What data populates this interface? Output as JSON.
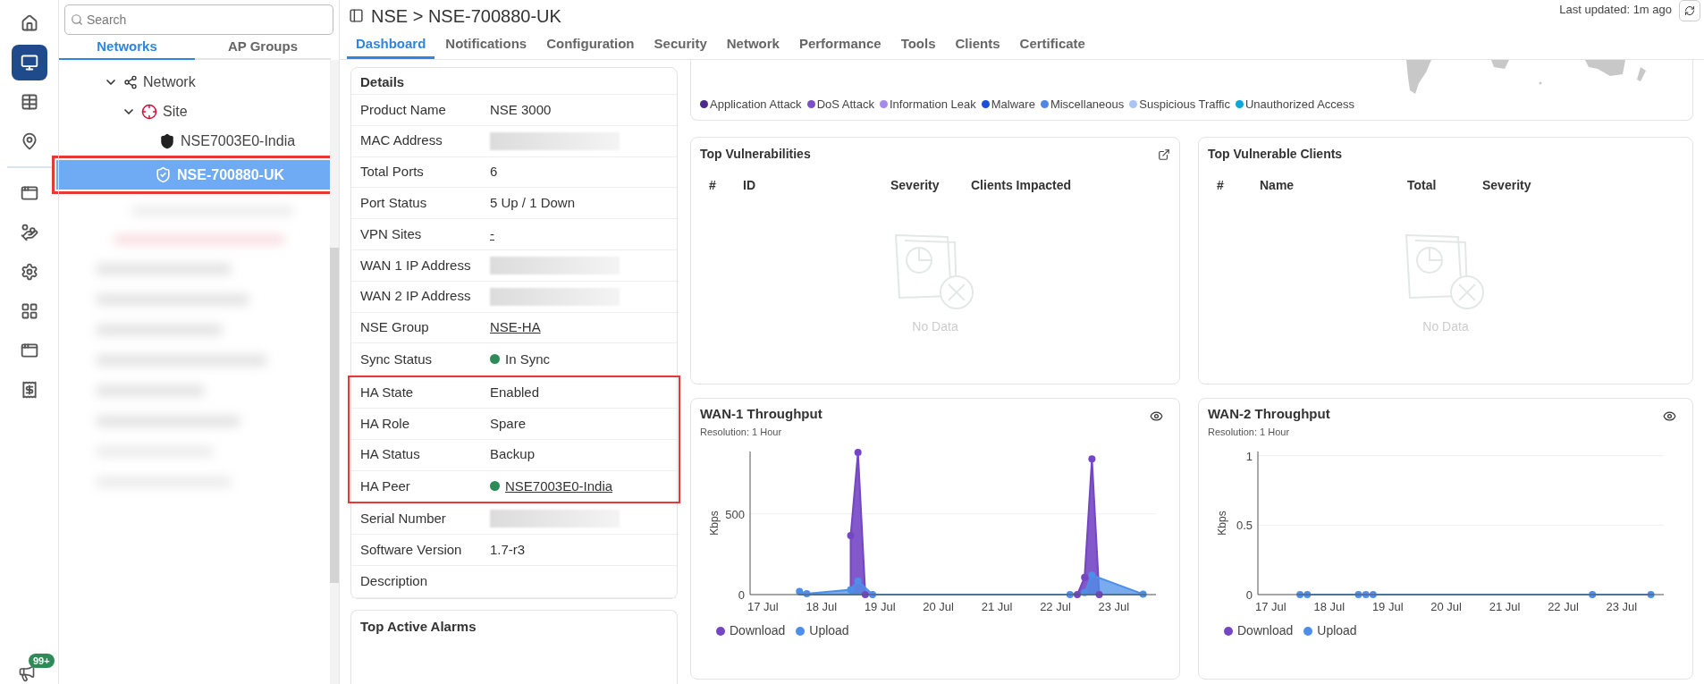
{
  "rail": {
    "items": [
      {
        "selected": false
      },
      {
        "selected": true
      },
      {
        "selected": false
      },
      {
        "selected": false
      },
      {
        "selected": false
      },
      {
        "selected": false
      },
      {
        "selected": false
      },
      {
        "selected": false
      },
      {
        "selected": false
      },
      {
        "selected": false
      }
    ],
    "badge": "99+"
  },
  "tree_panel": {
    "search": {
      "placeholder": "Search"
    },
    "tabs": [
      {
        "label": "Networks",
        "selected": true
      },
      {
        "label": "AP Groups",
        "selected": false
      }
    ],
    "tree": [
      {
        "kind": "network",
        "label": "Network",
        "expanded": true,
        "selected": false,
        "highlighted": false,
        "children": [
          {
            "kind": "site",
            "label": "Site",
            "expanded": true,
            "selected": false,
            "highlighted": false,
            "children": [
              {
                "kind": "nse",
                "label": "NSE7003E0-India",
                "selected": false,
                "highlighted": false
              },
              {
                "kind": "nse",
                "label": "NSE-700880-UK",
                "selected": true,
                "highlighted": true
              }
            ]
          }
        ]
      }
    ]
  },
  "header": {
    "breadcrumb": "NSE > NSE-700880-UK",
    "last_updated": "Last updated: 1m ago"
  },
  "tabs": [
    {
      "label": "Dashboard",
      "selected": true
    },
    {
      "label": "Notifications",
      "selected": false
    },
    {
      "label": "Configuration",
      "selected": false
    },
    {
      "label": "Security",
      "selected": false
    },
    {
      "label": "Network",
      "selected": false
    },
    {
      "label": "Performance",
      "selected": false
    },
    {
      "label": "Tools",
      "selected": false
    },
    {
      "label": "Clients",
      "selected": false
    },
    {
      "label": "Certificate",
      "selected": false
    }
  ],
  "details": {
    "title": "Details",
    "sections": [
      {
        "highlighted": false,
        "rows": [
          {
            "label": "Product Name",
            "kind": "text",
            "value": "NSE 3000"
          },
          {
            "label": "MAC Address",
            "kind": "redacted"
          },
          {
            "label": "Total Ports",
            "kind": "text",
            "value": "6"
          },
          {
            "label": "Port Status",
            "kind": "text",
            "value": "5 Up / 1 Down"
          },
          {
            "label": "VPN Sites",
            "kind": "link",
            "value": "-"
          },
          {
            "label": "WAN 1 IP Address",
            "kind": "redacted"
          },
          {
            "label": "WAN 2 IP Address",
            "kind": "redacted"
          },
          {
            "label": "NSE Group",
            "kind": "link",
            "value": "NSE-HA"
          },
          {
            "label": "Sync Status",
            "kind": "status",
            "value": "In Sync",
            "color": "#2e8b57"
          }
        ]
      },
      {
        "highlighted": true,
        "rows": [
          {
            "label": "HA State",
            "kind": "text",
            "value": "Enabled"
          },
          {
            "label": "HA Role",
            "kind": "text",
            "value": "Spare"
          },
          {
            "label": "HA Status",
            "kind": "text",
            "value": "Backup"
          },
          {
            "label": "HA Peer",
            "kind": "status_link",
            "value": "NSE7003E0-India",
            "color": "#2e8b57"
          }
        ]
      },
      {
        "highlighted": false,
        "rows": [
          {
            "label": "Serial Number",
            "kind": "redacted"
          },
          {
            "label": "Software Version",
            "kind": "text",
            "value": "1.7-r3"
          },
          {
            "label": "Description",
            "kind": "text"
          }
        ]
      }
    ]
  },
  "alarms": {
    "title": "Top Active Alarms"
  },
  "threat_map": {
    "legend": [
      {
        "label": "Application Attack",
        "color": "#4a2a8c"
      },
      {
        "label": "DoS Attack",
        "color": "#7b4fc6"
      },
      {
        "label": "Information Leak",
        "color": "#a68be6"
      },
      {
        "label": "Malware",
        "color": "#1b4fd8"
      },
      {
        "label": "Miscellaneous",
        "color": "#4f87e3"
      },
      {
        "label": "Suspicious Traffic",
        "color": "#a9c4f4"
      },
      {
        "label": "Unauthorized Access",
        "color": "#0ba6da"
      }
    ]
  },
  "vulnerabilities": {
    "title": "Top Vulnerabilities",
    "columns": [
      "#",
      "ID",
      "Severity",
      "Clients Impacted"
    ],
    "empty": "No Data"
  },
  "vulnerable_clients": {
    "title": "Top Vulnerable Clients",
    "columns": [
      "#",
      "Name",
      "Total",
      "Severity"
    ],
    "empty": "No Data"
  },
  "wan1": {
    "title": "WAN-1 Throughput",
    "subtitle": "Resolution: 1 Hour",
    "chart_data": {
      "type": "area",
      "ylabel": "Kbps",
      "categories": [
        "17 Jul",
        null,
        null,
        null,
        null,
        null,
        null,
        null,
        "18 Jul",
        null,
        null,
        null,
        null,
        null,
        null,
        null,
        "19 Jul",
        null,
        null,
        null,
        null,
        null,
        null,
        null,
        "20 Jul",
        null,
        null,
        null,
        null,
        null,
        null,
        null,
        "21 Jul",
        null,
        null,
        null,
        null,
        null,
        null,
        null,
        "22 Jul",
        null,
        null,
        null,
        null,
        null,
        null,
        null,
        "23 Jul",
        null,
        null,
        null,
        null,
        null
      ],
      "ylim": [
        0,
        886
      ],
      "yticks": [
        0,
        500
      ],
      "series": [
        {
          "name": "Download",
          "color": "#7446c4",
          "marker": "circle",
          "values": [
            null,
            null,
            null,
            null,
            null,
            null,
            null,
            null,
            null,
            null,
            null,
            null,
            365,
            880,
            0,
            null,
            null,
            null,
            null,
            null,
            null,
            null,
            null,
            null,
            null,
            null,
            null,
            null,
            null,
            null,
            null,
            null,
            null,
            null,
            null,
            null,
            null,
            null,
            null,
            null,
            null,
            null,
            null,
            0,
            107,
            840,
            0,
            null,
            null,
            null,
            null,
            null,
            null,
            null
          ]
        },
        {
          "name": "Upload",
          "color": "#4d8fe8",
          "marker": "circle",
          "values": [
            null,
            null,
            null,
            null,
            null,
            20,
            6,
            null,
            null,
            null,
            null,
            null,
            30,
            85,
            null,
            0,
            null,
            null,
            null,
            null,
            null,
            null,
            null,
            null,
            null,
            null,
            null,
            null,
            null,
            null,
            null,
            null,
            null,
            null,
            null,
            null,
            null,
            null,
            null,
            null,
            null,
            null,
            0,
            null,
            13,
            120,
            null,
            null,
            null,
            null,
            null,
            null,
            3,
            null
          ]
        }
      ],
      "legend": "bottom-left"
    }
  },
  "wan2": {
    "title": "WAN-2 Throughput",
    "subtitle": "Resolution: 1 Hour",
    "chart_data": {
      "type": "line",
      "ylabel": "Kbps",
      "categories": [
        "17 Jul",
        null,
        null,
        null,
        null,
        null,
        null,
        null,
        "18 Jul",
        null,
        null,
        null,
        null,
        null,
        null,
        null,
        "19 Jul",
        null,
        null,
        null,
        null,
        null,
        null,
        null,
        "20 Jul",
        null,
        null,
        null,
        null,
        null,
        null,
        null,
        "21 Jul",
        null,
        null,
        null,
        null,
        null,
        null,
        null,
        "22 Jul",
        null,
        null,
        null,
        null,
        null,
        null,
        null,
        "23 Jul",
        null,
        null,
        null,
        null,
        null
      ],
      "ylim": [
        0,
        1.03
      ],
      "yticks": [
        0,
        0.5,
        1
      ],
      "series": [
        {
          "name": "Download",
          "color": "#7446c4",
          "marker": "circle",
          "values": [
            null,
            null,
            null,
            null,
            null,
            null,
            null,
            null,
            null,
            null,
            null,
            null,
            null,
            null,
            null,
            null,
            null,
            null,
            null,
            null,
            null,
            null,
            null,
            null,
            null,
            null,
            null,
            null,
            null,
            null,
            null,
            null,
            null,
            null,
            null,
            null,
            null,
            null,
            null,
            null,
            null,
            null,
            null,
            null,
            null,
            null,
            null,
            null,
            null,
            null,
            null,
            null,
            null,
            null
          ]
        },
        {
          "name": "Upload",
          "color": "#4d8fe8",
          "marker": "circle",
          "values": [
            null,
            null,
            null,
            null,
            0,
            0,
            null,
            null,
            null,
            null,
            null,
            null,
            0,
            0,
            0,
            null,
            null,
            null,
            null,
            null,
            null,
            null,
            null,
            null,
            null,
            null,
            null,
            null,
            null,
            null,
            null,
            null,
            null,
            null,
            null,
            null,
            null,
            null,
            null,
            null,
            null,
            null,
            null,
            null,
            0,
            null,
            null,
            null,
            null,
            null,
            null,
            null,
            0,
            null
          ]
        }
      ],
      "legend": "bottom-left"
    }
  }
}
